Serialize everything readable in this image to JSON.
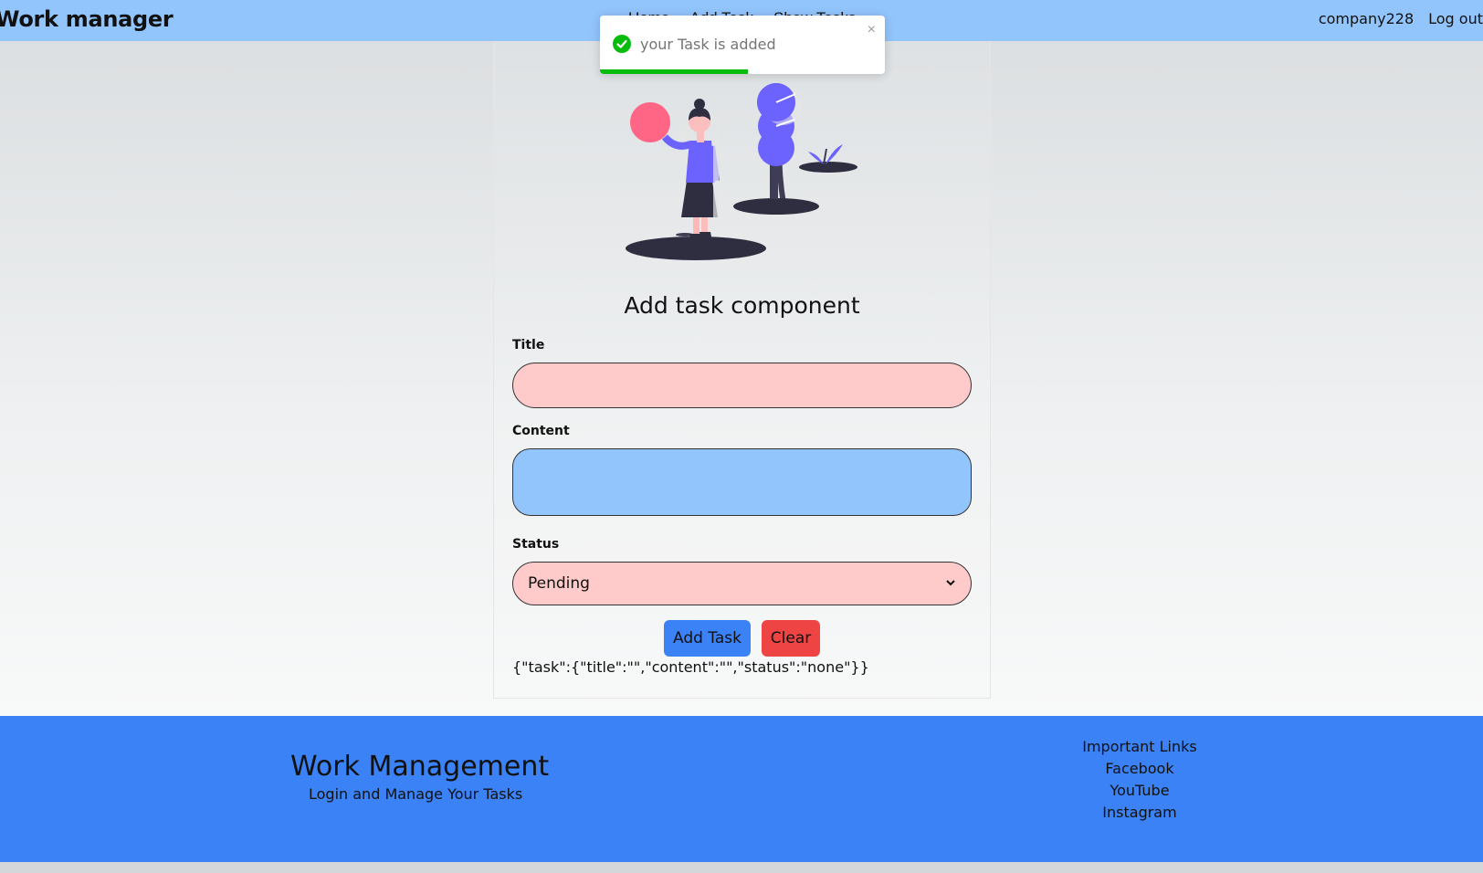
{
  "navbar": {
    "brand": "Work manager",
    "links": [
      "Home",
      "Add Task",
      "Show Tasks"
    ],
    "username": "company228",
    "logout": "Log out"
  },
  "toast": {
    "message": "your Task is added",
    "close": "×",
    "progress": 0.52,
    "accent": "#07bc0c"
  },
  "form": {
    "title": "Add task component",
    "title_label": "Title",
    "title_value": "",
    "content_label": "Content",
    "content_value": "",
    "status_label": "Status",
    "status_value": "Pending",
    "add_button": "Add Task",
    "clear_button": "Clear",
    "debug_json": "{\"task\":{\"title\":\"\",\"content\":\"\",\"status\":\"none\"}}"
  },
  "footer": {
    "title": "Work Management",
    "subtitle": "Login and Manage Your Tasks",
    "links_heading": "Important Links",
    "links": [
      "Facebook",
      "YouTube",
      "Instagram"
    ]
  },
  "colors": {
    "navbar": "#93c5fd",
    "footer": "#3b82f6",
    "title_input": "#fecaca",
    "content_input": "#93c5fd",
    "add_button": "#3b82f6",
    "clear_button": "#ef4444"
  },
  "icons": [
    "check-icon",
    "close-icon",
    "chevron-down-icon"
  ]
}
